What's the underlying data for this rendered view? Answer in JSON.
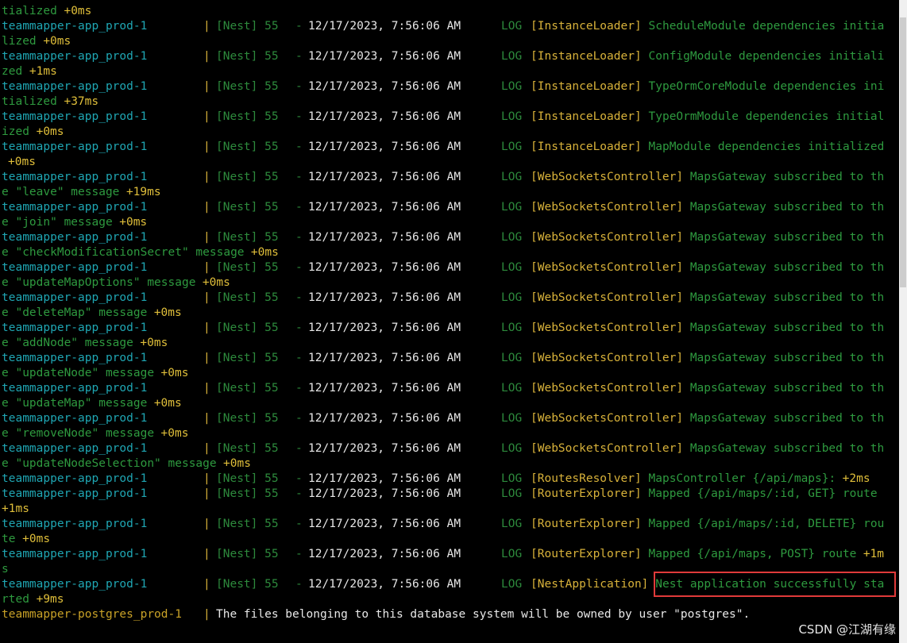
{
  "log_lines": [
    {
      "type": "cont",
      "text": "tialized",
      "tail": "+0ms"
    },
    {
      "type": "entry",
      "app": "teammapper-app_prod-1",
      "ctx": "[InstanceLoader]",
      "msg": "ScheduleModule dependencies initia"
    },
    {
      "type": "cont",
      "text": "lized",
      "tail": "+0ms"
    },
    {
      "type": "entry",
      "app": "teammapper-app_prod-1",
      "ctx": "[InstanceLoader]",
      "msg": "ConfigModule dependencies initiali"
    },
    {
      "type": "cont",
      "text": "zed",
      "tail": "+1ms"
    },
    {
      "type": "entry",
      "app": "teammapper-app_prod-1",
      "ctx": "[InstanceLoader]",
      "msg": "TypeOrmCoreModule dependencies ini"
    },
    {
      "type": "cont",
      "text": "tialized",
      "tail": "+37ms"
    },
    {
      "type": "entry",
      "app": "teammapper-app_prod-1",
      "ctx": "[InstanceLoader]",
      "msg": "TypeOrmModule dependencies initial"
    },
    {
      "type": "cont",
      "text": "ized",
      "tail": "+0ms"
    },
    {
      "type": "entry",
      "app": "teammapper-app_prod-1",
      "ctx": "[InstanceLoader]",
      "msg": "MapModule dependencies initialized"
    },
    {
      "type": "cont",
      "text": "",
      "tail": "+0ms"
    },
    {
      "type": "entry",
      "app": "teammapper-app_prod-1",
      "ctx": "[WebSocketsController]",
      "msg": "MapsGateway subscribed to th"
    },
    {
      "type": "cont",
      "text": "e \"leave\" message",
      "tail": "+19ms"
    },
    {
      "type": "entry",
      "app": "teammapper-app_prod-1",
      "ctx": "[WebSocketsController]",
      "msg": "MapsGateway subscribed to th"
    },
    {
      "type": "cont",
      "text": "e \"join\" message",
      "tail": "+0ms"
    },
    {
      "type": "entry",
      "app": "teammapper-app_prod-1",
      "ctx": "[WebSocketsController]",
      "msg": "MapsGateway subscribed to th"
    },
    {
      "type": "cont",
      "text": "e \"checkModificationSecret\" message",
      "tail": "+0ms"
    },
    {
      "type": "entry",
      "app": "teammapper-app_prod-1",
      "ctx": "[WebSocketsController]",
      "msg": "MapsGateway subscribed to th"
    },
    {
      "type": "cont",
      "text": "e \"updateMapOptions\" message",
      "tail": "+0ms"
    },
    {
      "type": "entry",
      "app": "teammapper-app_prod-1",
      "ctx": "[WebSocketsController]",
      "msg": "MapsGateway subscribed to th"
    },
    {
      "type": "cont",
      "text": "e \"deleteMap\" message",
      "tail": "+0ms"
    },
    {
      "type": "entry",
      "app": "teammapper-app_prod-1",
      "ctx": "[WebSocketsController]",
      "msg": "MapsGateway subscribed to th"
    },
    {
      "type": "cont",
      "text": "e \"addNode\" message",
      "tail": "+0ms"
    },
    {
      "type": "entry",
      "app": "teammapper-app_prod-1",
      "ctx": "[WebSocketsController]",
      "msg": "MapsGateway subscribed to th"
    },
    {
      "type": "cont",
      "text": "e \"updateNode\" message",
      "tail": "+0ms"
    },
    {
      "type": "entry",
      "app": "teammapper-app_prod-1",
      "ctx": "[WebSocketsController]",
      "msg": "MapsGateway subscribed to th"
    },
    {
      "type": "cont",
      "text": "e \"updateMap\" message",
      "tail": "+0ms"
    },
    {
      "type": "entry",
      "app": "teammapper-app_prod-1",
      "ctx": "[WebSocketsController]",
      "msg": "MapsGateway subscribed to th"
    },
    {
      "type": "cont",
      "text": "e \"removeNode\" message",
      "tail": "+0ms"
    },
    {
      "type": "entry",
      "app": "teammapper-app_prod-1",
      "ctx": "[WebSocketsController]",
      "msg": "MapsGateway subscribed to th"
    },
    {
      "type": "cont",
      "text": "e \"updateNodeSelection\" message",
      "tail": "+0ms"
    },
    {
      "type": "entry",
      "app": "teammapper-app_prod-1",
      "ctx": "[RoutesResolver]",
      "msg": "MapsController {/api/maps}:",
      "tail": "+2ms"
    },
    {
      "type": "entry",
      "app": "teammapper-app_prod-1",
      "ctx": "[RouterExplorer]",
      "msg": "Mapped {/api/maps/:id, GET} route"
    },
    {
      "type": "cont",
      "text": "",
      "tail": "+1ms"
    },
    {
      "type": "entry",
      "app": "teammapper-app_prod-1",
      "ctx": "[RouterExplorer]",
      "msg": "Mapped {/api/maps/:id, DELETE} rou"
    },
    {
      "type": "cont",
      "text": "te",
      "tail": "+0ms"
    },
    {
      "type": "entry",
      "app": "teammapper-app_prod-1",
      "ctx": "[RouterExplorer]",
      "msg": "Mapped {/api/maps, POST} route",
      "tail": "+1m"
    },
    {
      "type": "cont",
      "text": "s",
      "tail": ""
    },
    {
      "type": "entry",
      "app": "teammapper-app_prod-1",
      "ctx": "[NestApplication]",
      "msg": "Nest application successfully sta"
    },
    {
      "type": "cont",
      "text": "rted",
      "tail": "+9ms"
    },
    {
      "type": "pg",
      "app": "teammapper-postgres_prod-1",
      "msg": "The files belonging to this database system will be owned by user \"postgres\"."
    }
  ],
  "common": {
    "separator": "|",
    "source": "[Nest] 55",
    "dash": "-",
    "timestamp": "12/17/2023, 7:56:06 AM",
    "level": "LOG"
  },
  "watermark": "CSDN @江湖有缘"
}
